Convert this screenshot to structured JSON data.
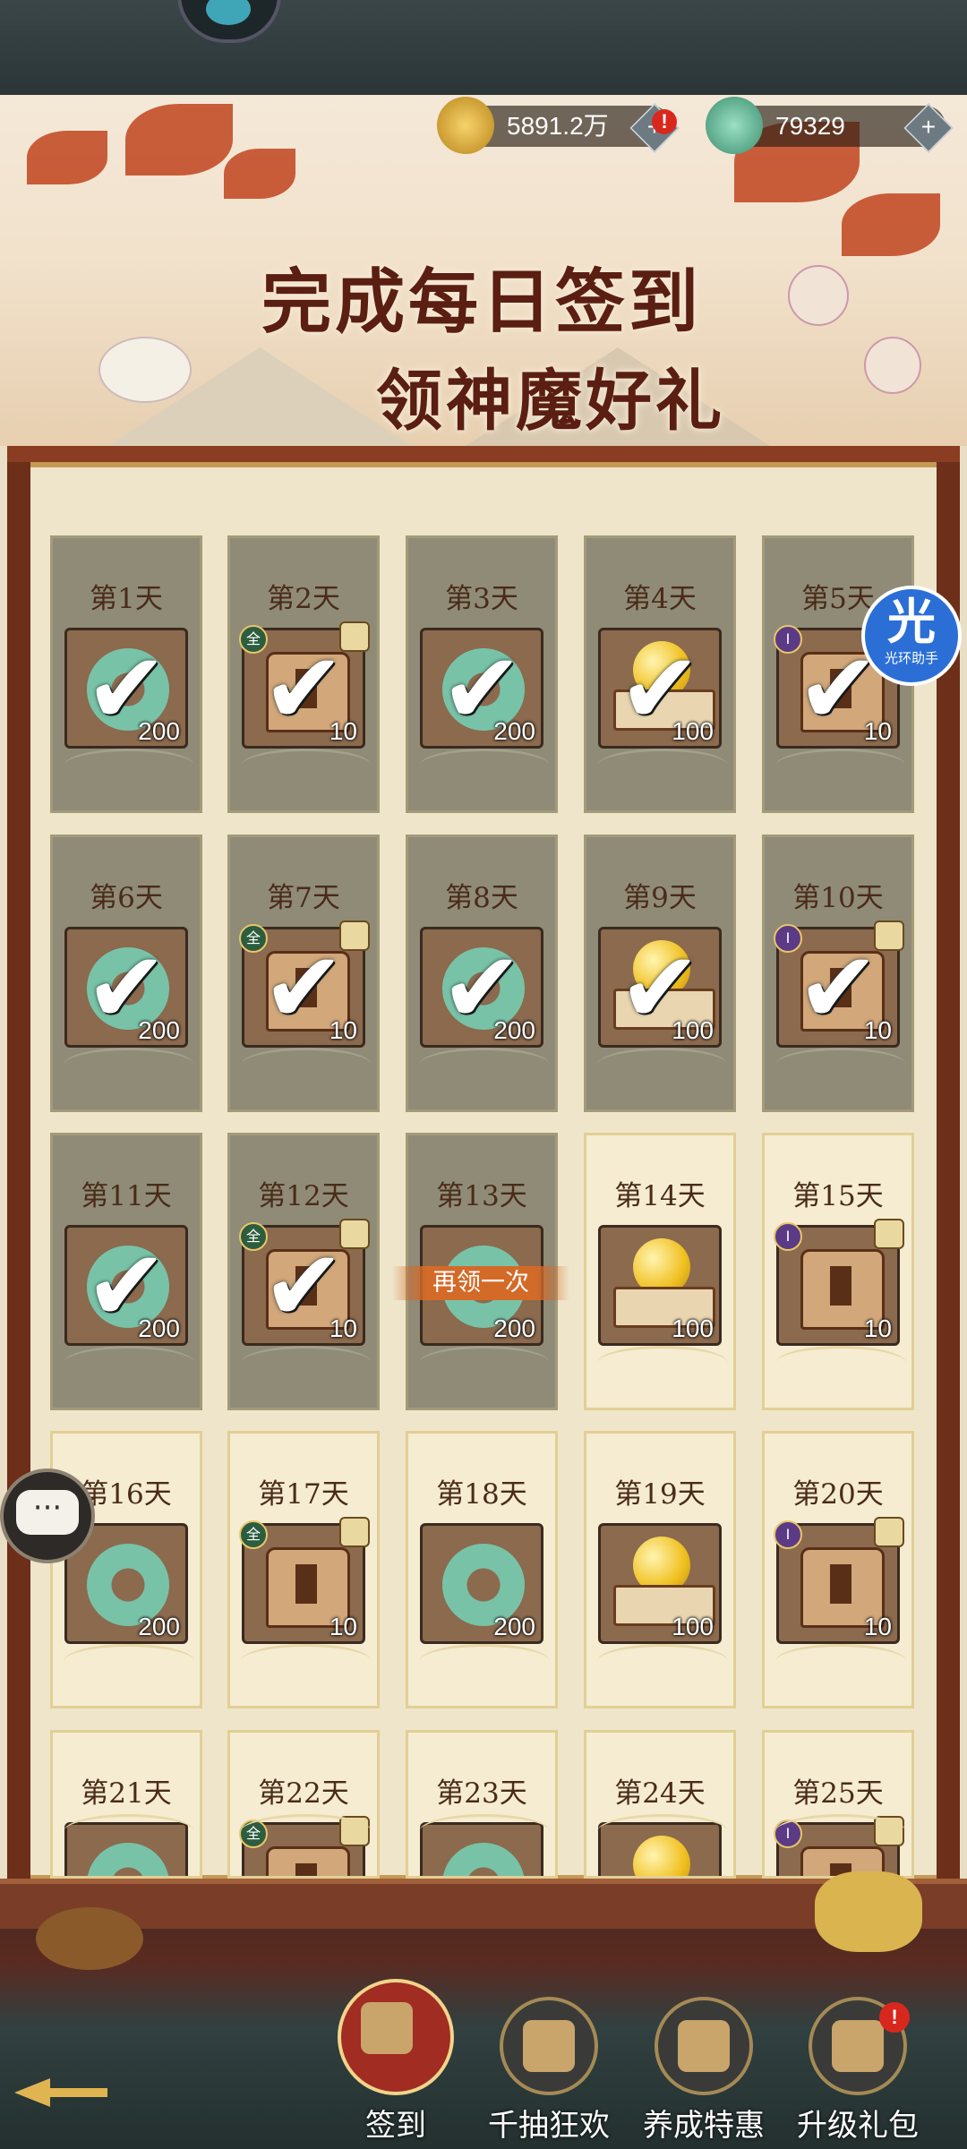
{
  "resources": {
    "coins": "5891.2万",
    "jade": "79329"
  },
  "banner": {
    "line1": "完成每日签到",
    "line2": "领神魔好礼"
  },
  "days": [
    {
      "label": "第1天",
      "qty": "200",
      "claimed": true,
      "item": "jade"
    },
    {
      "label": "第2天",
      "qty": "10",
      "claimed": true,
      "item": "chest",
      "tag": "全"
    },
    {
      "label": "第3天",
      "qty": "200",
      "claimed": true,
      "item": "jade"
    },
    {
      "label": "第4天",
      "qty": "100",
      "claimed": true,
      "item": "orb"
    },
    {
      "label": "第5天",
      "qty": "10",
      "claimed": true,
      "item": "chest",
      "tag": "I"
    },
    {
      "label": "第6天",
      "qty": "200",
      "claimed": true,
      "item": "jade"
    },
    {
      "label": "第7天",
      "qty": "10",
      "claimed": true,
      "item": "chest",
      "tag": "全"
    },
    {
      "label": "第8天",
      "qty": "200",
      "claimed": true,
      "item": "jade"
    },
    {
      "label": "第9天",
      "qty": "100",
      "claimed": true,
      "item": "orb"
    },
    {
      "label": "第10天",
      "qty": "10",
      "claimed": true,
      "item": "chest",
      "tag": "I"
    },
    {
      "label": "第11天",
      "qty": "200",
      "claimed": true,
      "item": "jade"
    },
    {
      "label": "第12天",
      "qty": "10",
      "claimed": true,
      "item": "chest",
      "tag": "全"
    },
    {
      "label": "第13天",
      "qty": "200",
      "claimed": false,
      "item": "jade",
      "dim": true
    },
    {
      "label": "第14天",
      "qty": "100",
      "claimed": false,
      "item": "orb"
    },
    {
      "label": "第15天",
      "qty": "10",
      "claimed": false,
      "item": "chest",
      "tag": "I"
    },
    {
      "label": "第16天",
      "qty": "200",
      "claimed": false,
      "item": "jade"
    },
    {
      "label": "第17天",
      "qty": "10",
      "claimed": false,
      "item": "chest",
      "tag": "全"
    },
    {
      "label": "第18天",
      "qty": "200",
      "claimed": false,
      "item": "jade"
    },
    {
      "label": "第19天",
      "qty": "100",
      "claimed": false,
      "item": "orb"
    },
    {
      "label": "第20天",
      "qty": "10",
      "claimed": false,
      "item": "chest",
      "tag": "I"
    },
    {
      "label": "第21天",
      "qty": "",
      "claimed": false,
      "item": "jade"
    },
    {
      "label": "第22天",
      "qty": "",
      "claimed": false,
      "item": "chest",
      "tag": "全"
    },
    {
      "label": "第23天",
      "qty": "",
      "claimed": false,
      "item": "jade"
    },
    {
      "label": "第24天",
      "qty": "",
      "claimed": false,
      "item": "orb"
    },
    {
      "label": "第25天",
      "qty": "",
      "claimed": false,
      "item": "chest",
      "tag": "I"
    }
  ],
  "reclaim_label": "再领一次",
  "helper": {
    "big": "光",
    "small": "光环助手"
  },
  "nav": [
    {
      "label": "签到",
      "icon": "sign-in-icon",
      "active": true
    },
    {
      "label": "千抽狂欢",
      "icon": "draw-carnival-icon",
      "active": false
    },
    {
      "label": "养成特惠",
      "icon": "growth-deal-icon",
      "active": false
    },
    {
      "label": "升级礼包",
      "icon": "upgrade-pack-icon",
      "active": false
    }
  ]
}
